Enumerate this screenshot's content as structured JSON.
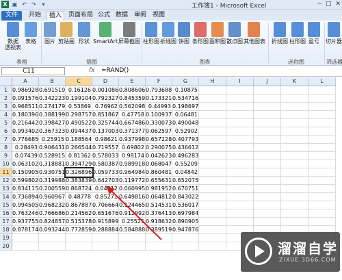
{
  "window": {
    "title": "工作簿1 - Microsoft Excel"
  },
  "tabs": [
    "文件",
    "开始",
    "插入",
    "页面布局",
    "公式",
    "数据",
    "审阅",
    "视图"
  ],
  "ribbon": {
    "buttons": [
      {
        "label": "数据\n透视表",
        "color": "#3b7bd1"
      },
      {
        "label": "表格",
        "color": "#4f8fd8"
      },
      {
        "label": "图片",
        "color": "#5a8fc9"
      },
      {
        "label": "剪贴画",
        "color": "#d9a441"
      },
      {
        "label": "形状",
        "color": "#4a86d0"
      },
      {
        "label": "SmartArt",
        "color": "#3ca65c"
      },
      {
        "label": "屏幕截图",
        "color": "#666666"
      },
      {
        "label": "柱形图",
        "color": "#3f7fcf"
      },
      {
        "label": "折线图",
        "color": "#4b8bd6"
      },
      {
        "label": "饼图",
        "color": "#3b78c4"
      },
      {
        "label": "条形图",
        "color": "#d9534f"
      },
      {
        "label": "面积图",
        "color": "#e07a2f"
      },
      {
        "label": "散点图",
        "color": "#4a7cc4"
      },
      {
        "label": "其他图表",
        "color": "#e06d2f"
      },
      {
        "label": "折线图",
        "color": "#3b7bd1"
      },
      {
        "label": "柱形图",
        "color": "#3b7bd1"
      },
      {
        "label": "盈亏",
        "color": "#3b7bd1"
      },
      {
        "label": "切片器",
        "color": "#3b7bd1"
      }
    ],
    "groups": [
      "表格",
      "插图",
      "图表",
      "迷你图",
      "筛选器"
    ]
  },
  "formula_bar": {
    "name_box": "C11",
    "fx": "fx",
    "formula": "=RAND()"
  },
  "columns": [
    "A",
    "B",
    "C",
    "D",
    "E",
    "F",
    "G",
    "H",
    "I",
    "J",
    "K",
    "L"
  ],
  "rows": [
    [
      "0.986928",
      "0.691519",
      "0.16126",
      "0.001086",
      "0.808606",
      "0.793688",
      "0.10875"
    ],
    [
      "0.091576",
      "0.342223",
      "0.199104",
      "0.792327",
      "0.845359",
      "0.173321",
      "0.534716"
    ],
    [
      "0.968511",
      "0.274179",
      "0.53869",
      "0.76962",
      "0.562098",
      "0.44993",
      "0.198697"
    ],
    [
      "0.180396",
      "0.388199",
      "0.298757",
      "0.851867",
      "0.47758",
      "0.100937",
      "0.06481"
    ],
    [
      "0.216442",
      "0.398427",
      "0.490522",
      "0.325744",
      "0.667486",
      "0.330073",
      "0.490048"
    ],
    [
      "0.993402",
      "0.367323",
      "0.094437",
      "0.137003",
      "0.371377",
      "0.062597",
      "0.52902"
    ],
    [
      "0.776685",
      "0.25915",
      "0.188564",
      "0.98621",
      "0.937998",
      "0.657228",
      "0.407793"
    ],
    [
      "0.28493",
      "0.906431",
      "0.266544",
      "0.719557",
      "0.69802",
      "0.290075",
      "0.436612"
    ],
    [
      "0.07439",
      "0.528915",
      "0.81362",
      "0.578033",
      "0.98174",
      "0.042623",
      "0.496283"
    ],
    [
      "0.063102",
      "0.318881",
      "0.394729",
      "0.580387",
      "0.989918",
      "0.068047",
      "0.55209"
    ],
    [
      "0.150905",
      "0.930751",
      "0.326896",
      "0.059733",
      "0.964984",
      "0.860481",
      "0.04842"
    ],
    [
      "0.599802",
      "0.319988",
      "0.383839",
      "0.642703",
      "0.119772",
      "0.655631",
      "0.652075"
    ],
    [
      "0.834115",
      "0.200559",
      "0.868724",
      "0.04912",
      "0.060995",
      "0.981952",
      "0.670751"
    ],
    [
      "0.736894",
      "0.960967",
      "0.48778",
      "0.85271",
      "0.649816",
      "0.064812",
      "0.843022"
    ],
    [
      "0.994505",
      "0.968232",
      "0.867887",
      "0.706664",
      "0.124465",
      "0.514531",
      "0.536017"
    ],
    [
      "0.763246",
      "0.766686",
      "0.214562",
      "0.651676",
      "0.912992",
      "0.376413",
      "0.697984"
    ],
    [
      "0.937755",
      "0.824857",
      "0.515378",
      "0.915899",
      "0.25525",
      "0.918632",
      "0.890905"
    ],
    [
      "0.878174",
      "0.093244",
      "0.772859",
      "0.288884",
      "0.584888",
      "0.389519",
      "0.947876"
    ]
  ],
  "extra_rows": [
    "19",
    "20"
  ],
  "watermark": {
    "title": "溜溜自学",
    "url": "ZIXUE.3D66.COM"
  }
}
